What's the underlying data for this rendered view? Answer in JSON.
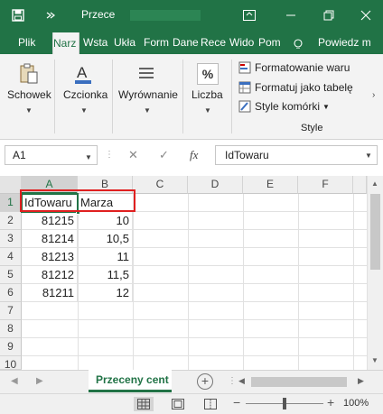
{
  "titlebar": {
    "title": "Przece",
    "icons": [
      "save-icon",
      "quick-access-more-icon",
      "ribbon-display-icon",
      "minimize-icon",
      "restore-icon",
      "close-icon"
    ]
  },
  "tabs": [
    {
      "label": "Plik"
    },
    {
      "label": "Narz"
    },
    {
      "label": "Wsta"
    },
    {
      "label": "Ukła"
    },
    {
      "label": "Form"
    },
    {
      "label": "Dane"
    },
    {
      "label": "Rece"
    },
    {
      "label": "Wido"
    },
    {
      "label": "Pom"
    },
    {
      "label": "Powiedz m"
    }
  ],
  "ribbon": {
    "clipboard": "Schowek",
    "font": "Czcionka",
    "alignment": "Wyrównanie",
    "number": "Liczba",
    "number_symbol": "%",
    "font_symbol": "A",
    "styles": {
      "conditional": "Formatowanie waru",
      "table": "Formatuj jako tabelę",
      "cell_styles": "Style komórki",
      "group_label": "Style"
    }
  },
  "formula_bar": {
    "name_box": "A1",
    "cancel": "✕",
    "enter": "✓",
    "fx": "fx",
    "content": "IdTowaru"
  },
  "sheet": {
    "columns": [
      "A",
      "B",
      "C",
      "D",
      "E",
      "F"
    ],
    "rows": [
      "1",
      "2",
      "3",
      "4",
      "5",
      "6",
      "7",
      "8",
      "9",
      "10"
    ],
    "cells": [
      [
        "IdTowaru",
        "Marza"
      ],
      [
        "81215",
        "10"
      ],
      [
        "81214",
        "10,5"
      ],
      [
        "81213",
        "11"
      ],
      [
        "81212",
        "11,5"
      ],
      [
        "81211",
        "12"
      ]
    ]
  },
  "sheet_tabs": {
    "active": "Przeceny cent",
    "add": "+"
  },
  "status": {
    "zoom": "100%",
    "minus": "−",
    "plus": "+"
  },
  "colors": {
    "brand": "#217346",
    "highlight": "#e02020"
  }
}
